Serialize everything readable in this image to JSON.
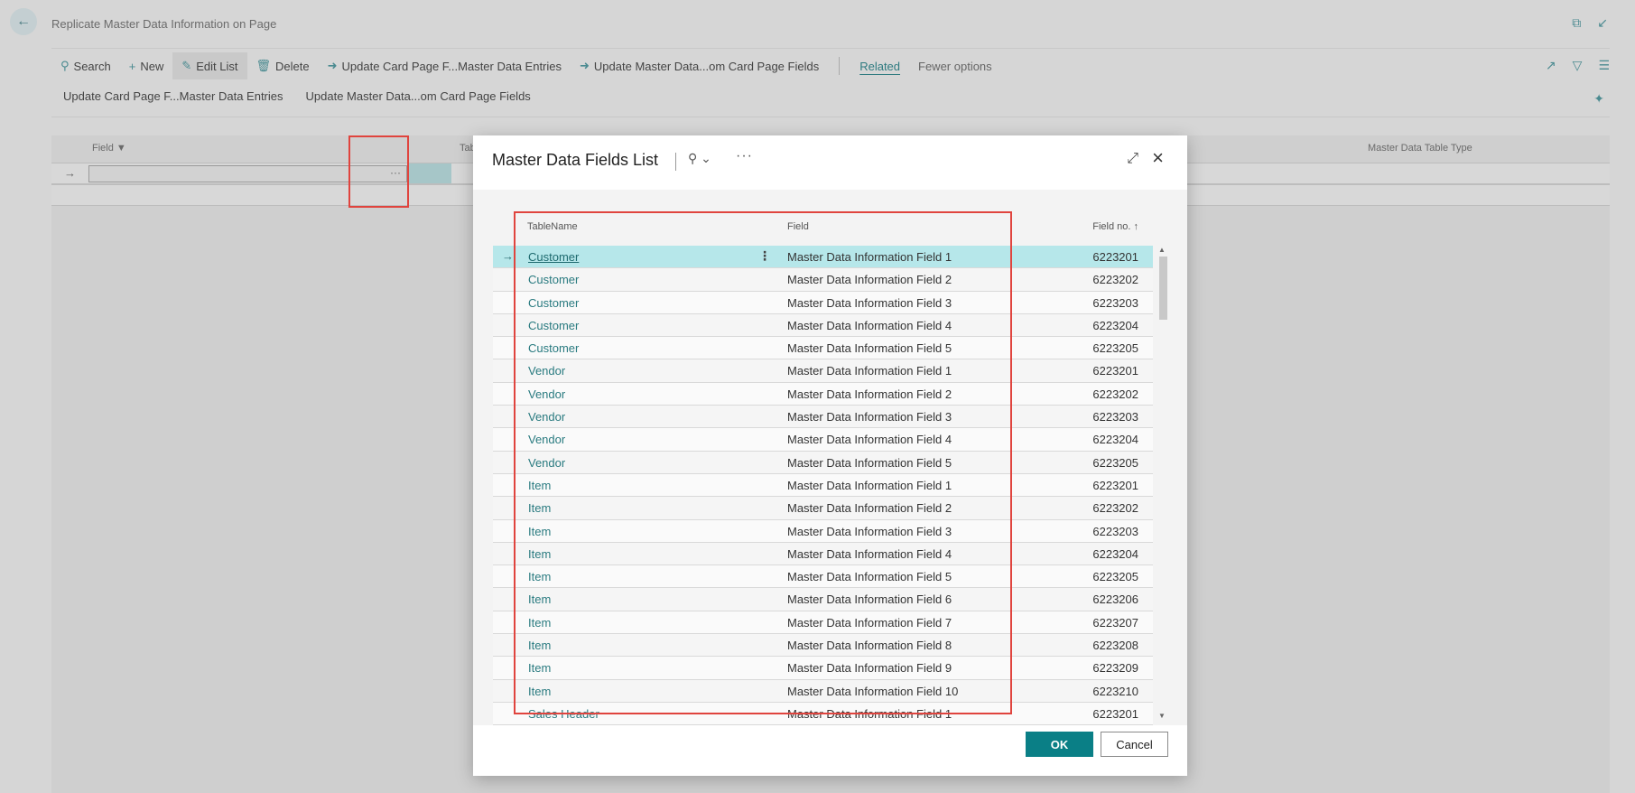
{
  "page": {
    "title": "Replicate Master Data Information on Page",
    "back_icon": "arrow-left-icon"
  },
  "actionbar": {
    "search": "Search",
    "new": "New",
    "edit_list": "Edit List",
    "delete": "Delete",
    "update_card_page": "Update Card Page F...Master Data Entries",
    "update_master_data": "Update Master Data...om Card Page Fields",
    "related": "Related",
    "fewer_options": "Fewer options"
  },
  "actionbar2": {
    "update_card_page": "Update Card Page F...Master Data Entries",
    "update_master_data": "Update Master Data...om Card Page Fields"
  },
  "bg_grid": {
    "col_field": "Field",
    "col_table": "Tab",
    "col_master_type": "Master Data Table Type"
  },
  "modal": {
    "title": "Master Data Fields List",
    "col_tablename": "TableName",
    "col_field": "Field",
    "col_fieldno": "Field no.",
    "ok": "OK",
    "cancel": "Cancel",
    "rows": [
      {
        "table": "Customer",
        "field": "Master Data Information Field 1",
        "no": "6223201"
      },
      {
        "table": "Customer",
        "field": "Master Data Information Field 2",
        "no": "6223202"
      },
      {
        "table": "Customer",
        "field": "Master Data Information Field 3",
        "no": "6223203"
      },
      {
        "table": "Customer",
        "field": "Master Data Information Field 4",
        "no": "6223204"
      },
      {
        "table": "Customer",
        "field": "Master Data Information Field 5",
        "no": "6223205"
      },
      {
        "table": "Vendor",
        "field": "Master Data Information Field 1",
        "no": "6223201"
      },
      {
        "table": "Vendor",
        "field": "Master Data Information Field 2",
        "no": "6223202"
      },
      {
        "table": "Vendor",
        "field": "Master Data Information Field 3",
        "no": "6223203"
      },
      {
        "table": "Vendor",
        "field": "Master Data Information Field 4",
        "no": "6223204"
      },
      {
        "table": "Vendor",
        "field": "Master Data Information Field 5",
        "no": "6223205"
      },
      {
        "table": "Item",
        "field": "Master Data Information Field 1",
        "no": "6223201"
      },
      {
        "table": "Item",
        "field": "Master Data Information Field 2",
        "no": "6223202"
      },
      {
        "table": "Item",
        "field": "Master Data Information Field 3",
        "no": "6223203"
      },
      {
        "table": "Item",
        "field": "Master Data Information Field 4",
        "no": "6223204"
      },
      {
        "table": "Item",
        "field": "Master Data Information Field 5",
        "no": "6223205"
      },
      {
        "table": "Item",
        "field": "Master Data Information Field 6",
        "no": "6223206"
      },
      {
        "table": "Item",
        "field": "Master Data Information Field 7",
        "no": "6223207"
      },
      {
        "table": "Item",
        "field": "Master Data Information Field 8",
        "no": "6223208"
      },
      {
        "table": "Item",
        "field": "Master Data Information Field 9",
        "no": "6223209"
      },
      {
        "table": "Item",
        "field": "Master Data Information Field 10",
        "no": "6223210"
      },
      {
        "table": "Sales Header",
        "field": "Master Data Information Field 1",
        "no": "6223201"
      }
    ]
  },
  "colors": {
    "accent": "#0a7f86",
    "highlight": "#e0443e",
    "selected_row": "#b6e7ea"
  }
}
